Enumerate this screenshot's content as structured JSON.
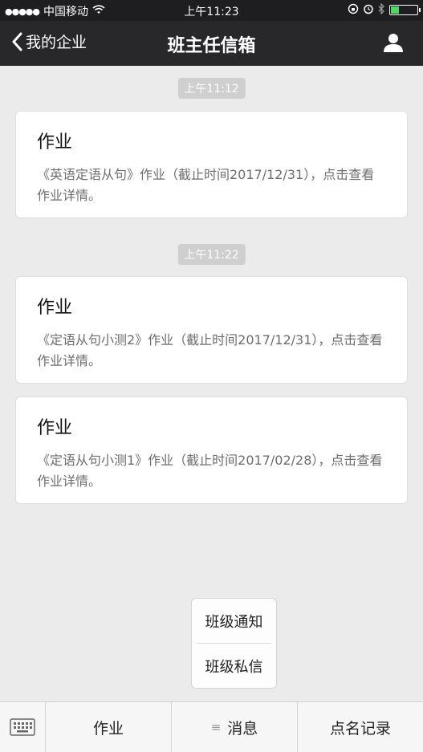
{
  "status_bar": {
    "signal": "●●●●●",
    "carrier": "中国移动",
    "time": "上午11:23"
  },
  "nav": {
    "back_label": "我的企业",
    "title": "班主任信箱"
  },
  "messages": [
    {
      "time": "上午11:12",
      "title": "作业",
      "desc": "《英语定语从句》作业（截止时间2017/12/31），点击查看作业详情。"
    },
    {
      "time": "上午11:22",
      "title": "作业",
      "desc": "《定语从句小测2》作业（截止时间2017/12/31），点击查看作业详情。"
    },
    {
      "time": "",
      "title": "作业",
      "desc": "《定语从句小测1》作业（截止时间2017/02/28），点击查看作业详情。"
    }
  ],
  "popup_menu": {
    "items": [
      "班级通知",
      "班级私信"
    ]
  },
  "tab_bar": {
    "tabs": [
      "作业",
      "消息",
      "点名记录"
    ],
    "menu_glyph": "≡"
  },
  "colors": {
    "nav_bg": "#28282a",
    "chat_bg": "#ebebeb",
    "battery": "#4cd964"
  },
  "icons": [
    "wifi-icon",
    "lock-rotation-icon",
    "alarm-icon",
    "bluetooth-icon",
    "battery-icon",
    "back-chevron-icon",
    "user-icon",
    "keyboard-icon",
    "menu-icon"
  ],
  "battery_level": 0.3
}
